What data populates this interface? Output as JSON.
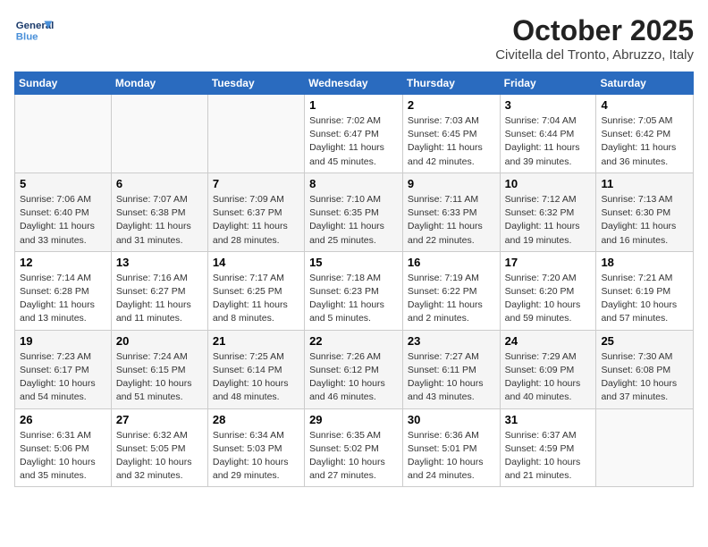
{
  "header": {
    "logo_general": "General",
    "logo_blue": "Blue",
    "month": "October 2025",
    "location": "Civitella del Tronto, Abruzzo, Italy"
  },
  "days_of_week": [
    "Sunday",
    "Monday",
    "Tuesday",
    "Wednesday",
    "Thursday",
    "Friday",
    "Saturday"
  ],
  "weeks": [
    [
      {
        "day": "",
        "info": ""
      },
      {
        "day": "",
        "info": ""
      },
      {
        "day": "",
        "info": ""
      },
      {
        "day": "1",
        "info": "Sunrise: 7:02 AM\nSunset: 6:47 PM\nDaylight: 11 hours\nand 45 minutes."
      },
      {
        "day": "2",
        "info": "Sunrise: 7:03 AM\nSunset: 6:45 PM\nDaylight: 11 hours\nand 42 minutes."
      },
      {
        "day": "3",
        "info": "Sunrise: 7:04 AM\nSunset: 6:44 PM\nDaylight: 11 hours\nand 39 minutes."
      },
      {
        "day": "4",
        "info": "Sunrise: 7:05 AM\nSunset: 6:42 PM\nDaylight: 11 hours\nand 36 minutes."
      }
    ],
    [
      {
        "day": "5",
        "info": "Sunrise: 7:06 AM\nSunset: 6:40 PM\nDaylight: 11 hours\nand 33 minutes."
      },
      {
        "day": "6",
        "info": "Sunrise: 7:07 AM\nSunset: 6:38 PM\nDaylight: 11 hours\nand 31 minutes."
      },
      {
        "day": "7",
        "info": "Sunrise: 7:09 AM\nSunset: 6:37 PM\nDaylight: 11 hours\nand 28 minutes."
      },
      {
        "day": "8",
        "info": "Sunrise: 7:10 AM\nSunset: 6:35 PM\nDaylight: 11 hours\nand 25 minutes."
      },
      {
        "day": "9",
        "info": "Sunrise: 7:11 AM\nSunset: 6:33 PM\nDaylight: 11 hours\nand 22 minutes."
      },
      {
        "day": "10",
        "info": "Sunrise: 7:12 AM\nSunset: 6:32 PM\nDaylight: 11 hours\nand 19 minutes."
      },
      {
        "day": "11",
        "info": "Sunrise: 7:13 AM\nSunset: 6:30 PM\nDaylight: 11 hours\nand 16 minutes."
      }
    ],
    [
      {
        "day": "12",
        "info": "Sunrise: 7:14 AM\nSunset: 6:28 PM\nDaylight: 11 hours\nand 13 minutes."
      },
      {
        "day": "13",
        "info": "Sunrise: 7:16 AM\nSunset: 6:27 PM\nDaylight: 11 hours\nand 11 minutes."
      },
      {
        "day": "14",
        "info": "Sunrise: 7:17 AM\nSunset: 6:25 PM\nDaylight: 11 hours\nand 8 minutes."
      },
      {
        "day": "15",
        "info": "Sunrise: 7:18 AM\nSunset: 6:23 PM\nDaylight: 11 hours\nand 5 minutes."
      },
      {
        "day": "16",
        "info": "Sunrise: 7:19 AM\nSunset: 6:22 PM\nDaylight: 11 hours\nand 2 minutes."
      },
      {
        "day": "17",
        "info": "Sunrise: 7:20 AM\nSunset: 6:20 PM\nDaylight: 10 hours\nand 59 minutes."
      },
      {
        "day": "18",
        "info": "Sunrise: 7:21 AM\nSunset: 6:19 PM\nDaylight: 10 hours\nand 57 minutes."
      }
    ],
    [
      {
        "day": "19",
        "info": "Sunrise: 7:23 AM\nSunset: 6:17 PM\nDaylight: 10 hours\nand 54 minutes."
      },
      {
        "day": "20",
        "info": "Sunrise: 7:24 AM\nSunset: 6:15 PM\nDaylight: 10 hours\nand 51 minutes."
      },
      {
        "day": "21",
        "info": "Sunrise: 7:25 AM\nSunset: 6:14 PM\nDaylight: 10 hours\nand 48 minutes."
      },
      {
        "day": "22",
        "info": "Sunrise: 7:26 AM\nSunset: 6:12 PM\nDaylight: 10 hours\nand 46 minutes."
      },
      {
        "day": "23",
        "info": "Sunrise: 7:27 AM\nSunset: 6:11 PM\nDaylight: 10 hours\nand 43 minutes."
      },
      {
        "day": "24",
        "info": "Sunrise: 7:29 AM\nSunset: 6:09 PM\nDaylight: 10 hours\nand 40 minutes."
      },
      {
        "day": "25",
        "info": "Sunrise: 7:30 AM\nSunset: 6:08 PM\nDaylight: 10 hours\nand 37 minutes."
      }
    ],
    [
      {
        "day": "26",
        "info": "Sunrise: 6:31 AM\nSunset: 5:06 PM\nDaylight: 10 hours\nand 35 minutes."
      },
      {
        "day": "27",
        "info": "Sunrise: 6:32 AM\nSunset: 5:05 PM\nDaylight: 10 hours\nand 32 minutes."
      },
      {
        "day": "28",
        "info": "Sunrise: 6:34 AM\nSunset: 5:03 PM\nDaylight: 10 hours\nand 29 minutes."
      },
      {
        "day": "29",
        "info": "Sunrise: 6:35 AM\nSunset: 5:02 PM\nDaylight: 10 hours\nand 27 minutes."
      },
      {
        "day": "30",
        "info": "Sunrise: 6:36 AM\nSunset: 5:01 PM\nDaylight: 10 hours\nand 24 minutes."
      },
      {
        "day": "31",
        "info": "Sunrise: 6:37 AM\nSunset: 4:59 PM\nDaylight: 10 hours\nand 21 minutes."
      },
      {
        "day": "",
        "info": ""
      }
    ]
  ]
}
